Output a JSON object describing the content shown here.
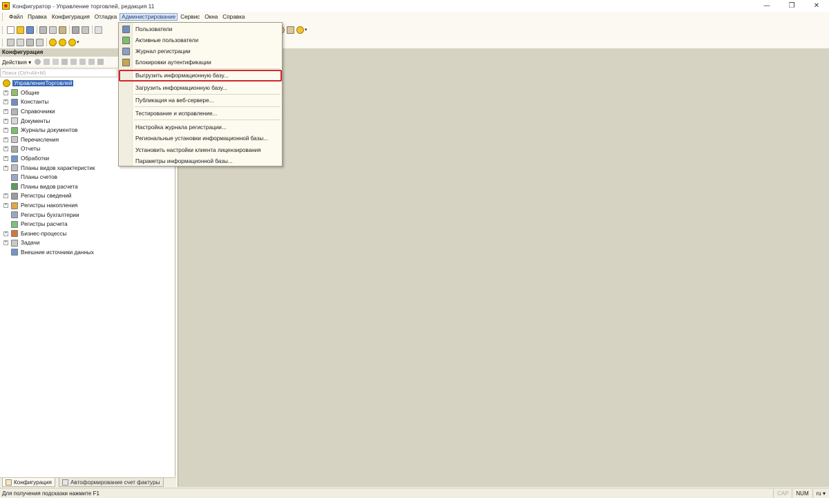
{
  "window": {
    "title": "Конфигуратор - Управление торговлей, редакция 11",
    "minimize_glyph": "—",
    "restore_glyph": "❐",
    "close_glyph": "✕"
  },
  "menubar": {
    "items": [
      "Файл",
      "Правка",
      "Конфигурация",
      "Отладка",
      "Администрирование",
      "Сервис",
      "Окна",
      "Справка"
    ],
    "active": "Администрирование"
  },
  "admin_menu": {
    "items": [
      {
        "label": "Пользователи",
        "icon": "users-icon"
      },
      {
        "label": "Активные пользователи",
        "icon": "active-users-icon"
      },
      {
        "label": "Журнал регистрации",
        "icon": "event-log-icon"
      },
      {
        "label": "Блокировки аутентификации",
        "icon": "auth-lock-icon"
      },
      {
        "label": "Выгрузить информационную базу...",
        "icon": ""
      },
      {
        "label": "Загрузить информационную базу...",
        "icon": ""
      },
      {
        "label": "Публикация на веб-сервере...",
        "icon": ""
      },
      {
        "label": "Тестирование и исправление...",
        "icon": ""
      },
      {
        "label": "Настройка журнала регистрации...",
        "icon": ""
      },
      {
        "label": "Региональные установки информационной базы...",
        "icon": ""
      },
      {
        "label": "Установить настройки клиента лицензирования",
        "icon": ""
      },
      {
        "label": "Параметры информационной базы...",
        "icon": ""
      }
    ],
    "highlighted": "Выгрузить информационную базу...",
    "highlight_color": "#d2262b"
  },
  "config_panel": {
    "title": "Конфигурация",
    "actions_label": "Действия",
    "search_placeholder": "Поиск (Ctrl+Alt+M)",
    "root": "УправлениеТорговлей",
    "tree": [
      {
        "label": "Общие",
        "expandable": true,
        "icon": "common-icon"
      },
      {
        "label": "Константы",
        "expandable": true,
        "icon": "constants-icon"
      },
      {
        "label": "Справочники",
        "expandable": true,
        "icon": "catalogs-icon"
      },
      {
        "label": "Документы",
        "expandable": true,
        "icon": "documents-icon"
      },
      {
        "label": "Журналы документов",
        "expandable": true,
        "icon": "doc-journals-icon"
      },
      {
        "label": "Перечисления",
        "expandable": true,
        "icon": "enums-icon"
      },
      {
        "label": "Отчеты",
        "expandable": true,
        "icon": "reports-icon"
      },
      {
        "label": "Обработки",
        "expandable": true,
        "icon": "data-processors-icon"
      },
      {
        "label": "Планы видов характеристик",
        "expandable": true,
        "icon": "char-types-icon"
      },
      {
        "label": "Планы счетов",
        "expandable": false,
        "icon": "chart-of-accounts-icon"
      },
      {
        "label": "Планы видов расчета",
        "expandable": false,
        "icon": "calc-types-icon"
      },
      {
        "label": "Регистры сведений",
        "expandable": true,
        "icon": "info-registers-icon"
      },
      {
        "label": "Регистры накопления",
        "expandable": true,
        "icon": "accum-registers-icon"
      },
      {
        "label": "Регистры бухгалтерии",
        "expandable": false,
        "icon": "accounting-registers-icon"
      },
      {
        "label": "Регистры расчета",
        "expandable": false,
        "icon": "calc-registers-icon"
      },
      {
        "label": "Бизнес-процессы",
        "expandable": true,
        "icon": "business-processes-icon"
      },
      {
        "label": "Задачи",
        "expandable": true,
        "icon": "tasks-icon"
      },
      {
        "label": "Внешние источники данных",
        "expandable": false,
        "icon": "external-sources-icon"
      }
    ]
  },
  "bottom_tabs": [
    "Конфигурация",
    "Автоформирование счет фактуры"
  ],
  "statusbar": {
    "hint": "Для получения подсказки нажмите F1",
    "cap": "CAP",
    "num": "NUM",
    "lang": "ru"
  },
  "colors": {
    "workspace": "#d6d3c2",
    "selection": "#3263b6",
    "accent_yellow": "#e8b800"
  }
}
